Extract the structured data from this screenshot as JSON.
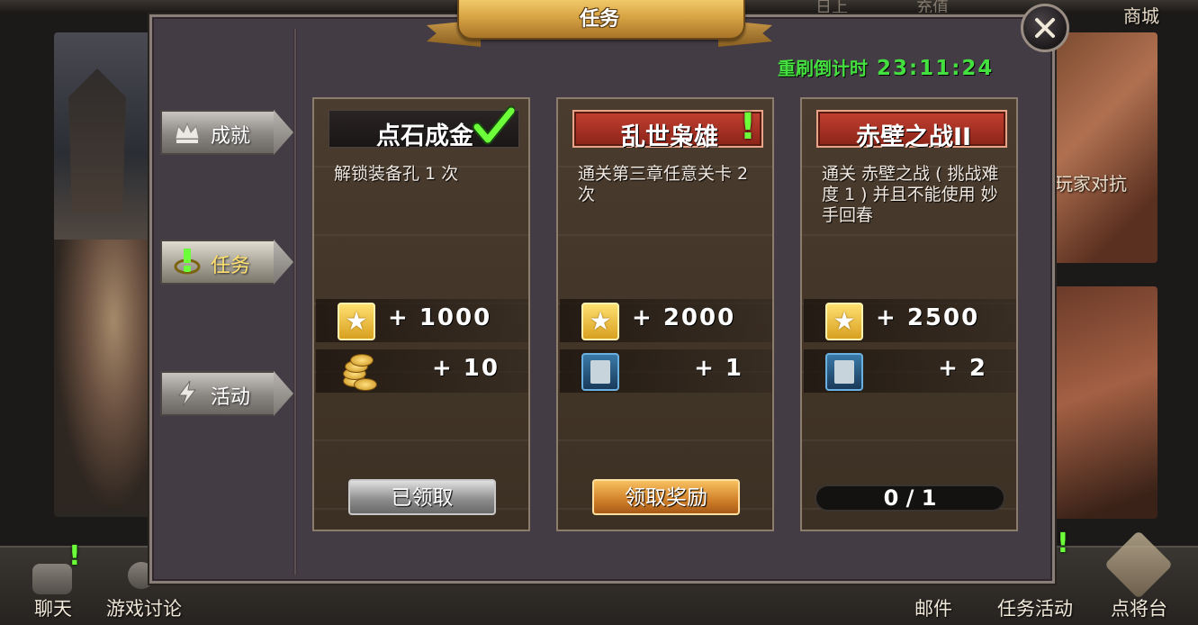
{
  "background": {
    "top_hints": [
      "日上",
      "充值"
    ],
    "shop_label": "商城",
    "pvp_label": "玩家对抗"
  },
  "bottom_bar": {
    "chat": "聊天",
    "discussion": "游戏讨论",
    "mail": "邮件",
    "task_activity": "任务活动",
    "general_stage": "点将台"
  },
  "dialog": {
    "title": "任务",
    "refresh_label": "重刷倒计时",
    "refresh_time": "23:11:24"
  },
  "tabs": [
    {
      "label": "成就",
      "icon": "crown-icon",
      "active": false
    },
    {
      "label": "任务",
      "icon": "eye-alert-icon",
      "active": true
    },
    {
      "label": "活动",
      "icon": "lightning-icon",
      "active": false
    }
  ],
  "tasks": [
    {
      "name": "点石成金",
      "status_icon": "checkmark-icon",
      "description": "解锁装备孔 1 次",
      "rewards": [
        {
          "icon": "star-icon",
          "value": "+ 1000"
        },
        {
          "icon": "gold-coins-icon",
          "value": "+ 10"
        }
      ],
      "action": "已领取"
    },
    {
      "name": "乱世枭雄",
      "status_icon": "exclamation-icon",
      "description": "通关第三章任意关卡 2 次",
      "rewards": [
        {
          "icon": "star-icon",
          "value": "+ 2000"
        },
        {
          "icon": "card-pack-icon",
          "value": "+ 1"
        }
      ],
      "action": "领取奖励"
    },
    {
      "name": "赤壁之战II",
      "description": "通关 赤壁之战 ( 挑战难度 1 ) 并且不能使用 妙手回春",
      "rewards": [
        {
          "icon": "star-icon",
          "value": "+ 2500"
        },
        {
          "icon": "card-pack-icon",
          "value": "+ 2"
        }
      ],
      "progress": "0 / 1"
    }
  ],
  "colors": {
    "accent_green": "#44e040",
    "title_gold": "#d8a444",
    "button_gold": "#d08028"
  }
}
